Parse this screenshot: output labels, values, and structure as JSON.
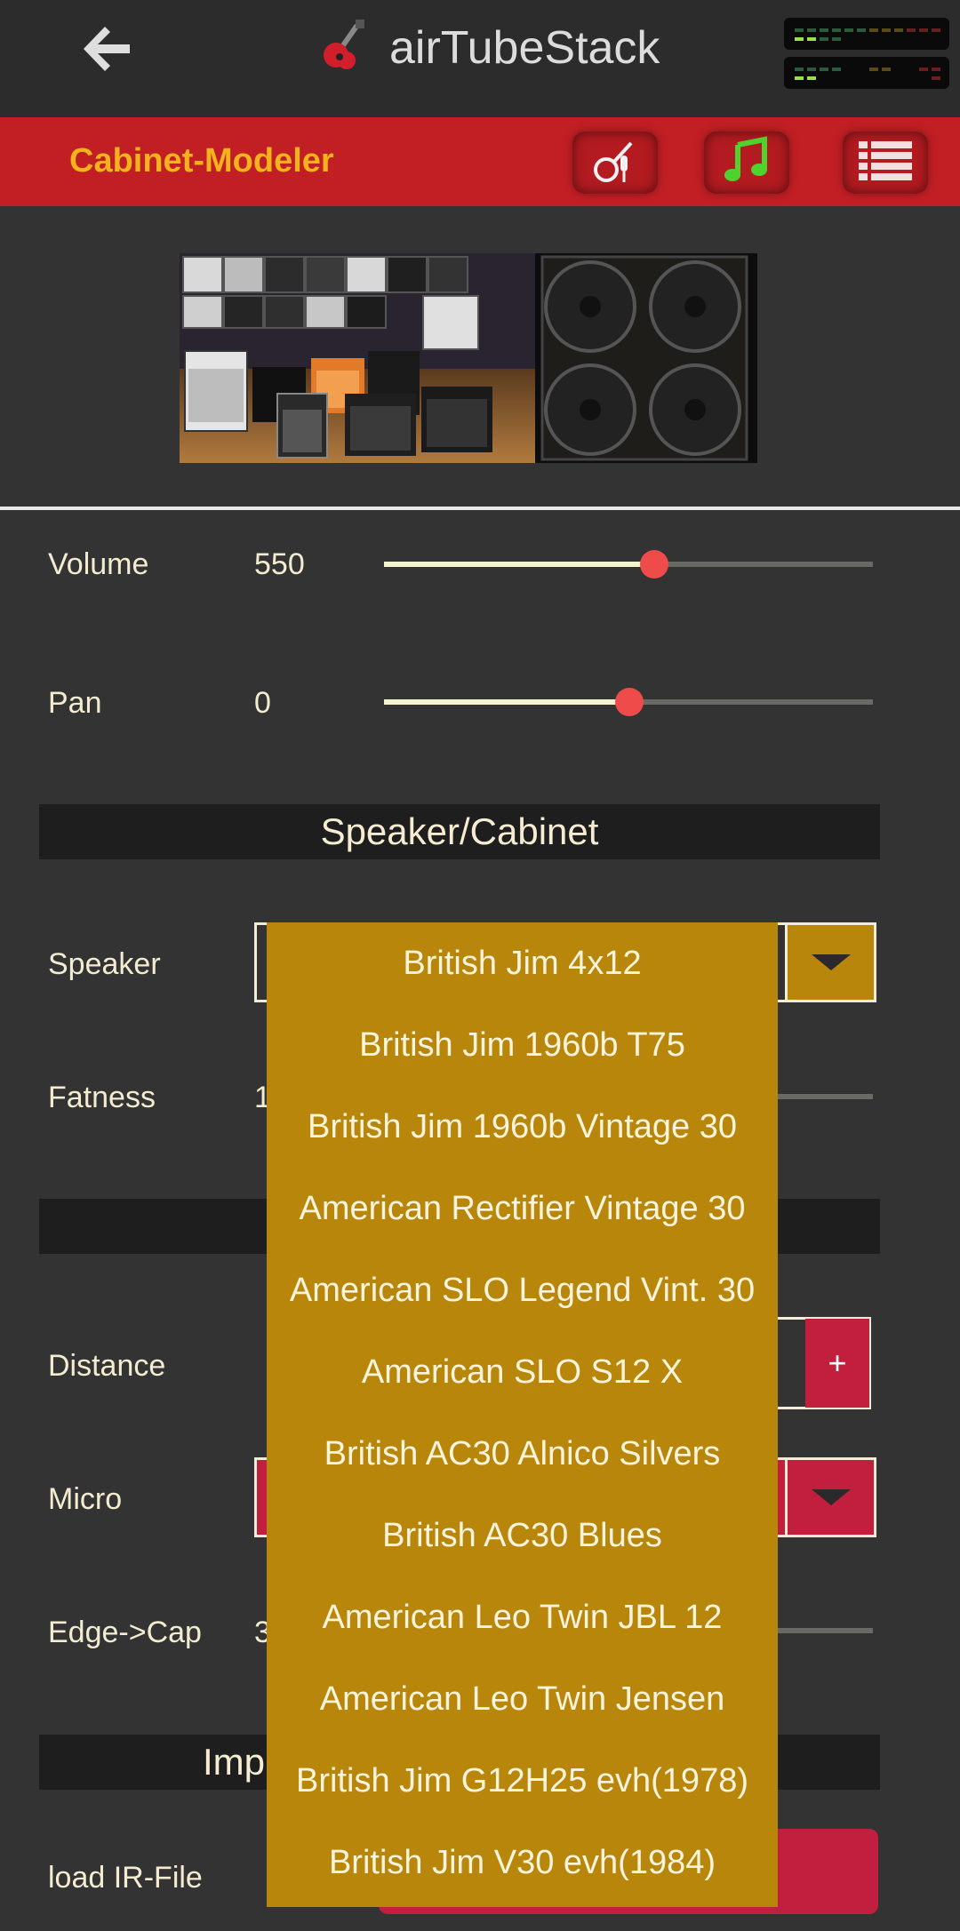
{
  "app": {
    "title": "airTubeStack",
    "icons": {
      "back": "back-arrow-icon",
      "logo": "guitar-icon",
      "meters": "level-meter-icon"
    }
  },
  "subbar": {
    "title": "Cabinet-Modeler",
    "buttons": [
      {
        "name": "instrument-button",
        "icon": "guitar-mic-icon"
      },
      {
        "name": "music-button",
        "icon": "music-note-icon"
      },
      {
        "name": "menu-button",
        "icon": "list-icon"
      }
    ]
  },
  "controls": {
    "volume": {
      "label": "Volume",
      "value": "550",
      "level": 0.55
    },
    "pan": {
      "label": "Pan",
      "value": "0",
      "level": 0.5
    },
    "fatness": {
      "label": "Fatness",
      "value": "1"
    },
    "distance": {
      "label": "Distance",
      "plus": "+"
    },
    "micro": {
      "label": "Micro"
    },
    "edge_cap": {
      "label": "Edge->Cap",
      "value": "3"
    },
    "load_ir": {
      "label": "load IR-File"
    }
  },
  "sections": {
    "speaker_cabinet": "Speaker/Cabinet",
    "impulse_partial": "Imp"
  },
  "speaker": {
    "label": "Speaker"
  },
  "dropdown": {
    "options": [
      "British Jim 4x12",
      "British Jim 1960b T75",
      "British Jim 1960b Vintage 30",
      "American Rectifier Vintage 30",
      "American SLO Legend Vint. 30",
      "American SLO S12 X",
      "British AC30 Alnico Silvers",
      "British AC30 Blues",
      "American Leo Twin JBL 12",
      "American Leo Twin Jensen",
      "British Jim G12H25 evh(1978)",
      "British Jim V30 evh(1984)"
    ]
  },
  "colors": {
    "background": "#333333",
    "appbar": "#2c2c2c",
    "subbar": "#c21f24",
    "accent_title": "#f4b21c",
    "dropdown": "#b8860b",
    "thumb": "#ef4b4b",
    "button_red": "#c21f3e"
  }
}
